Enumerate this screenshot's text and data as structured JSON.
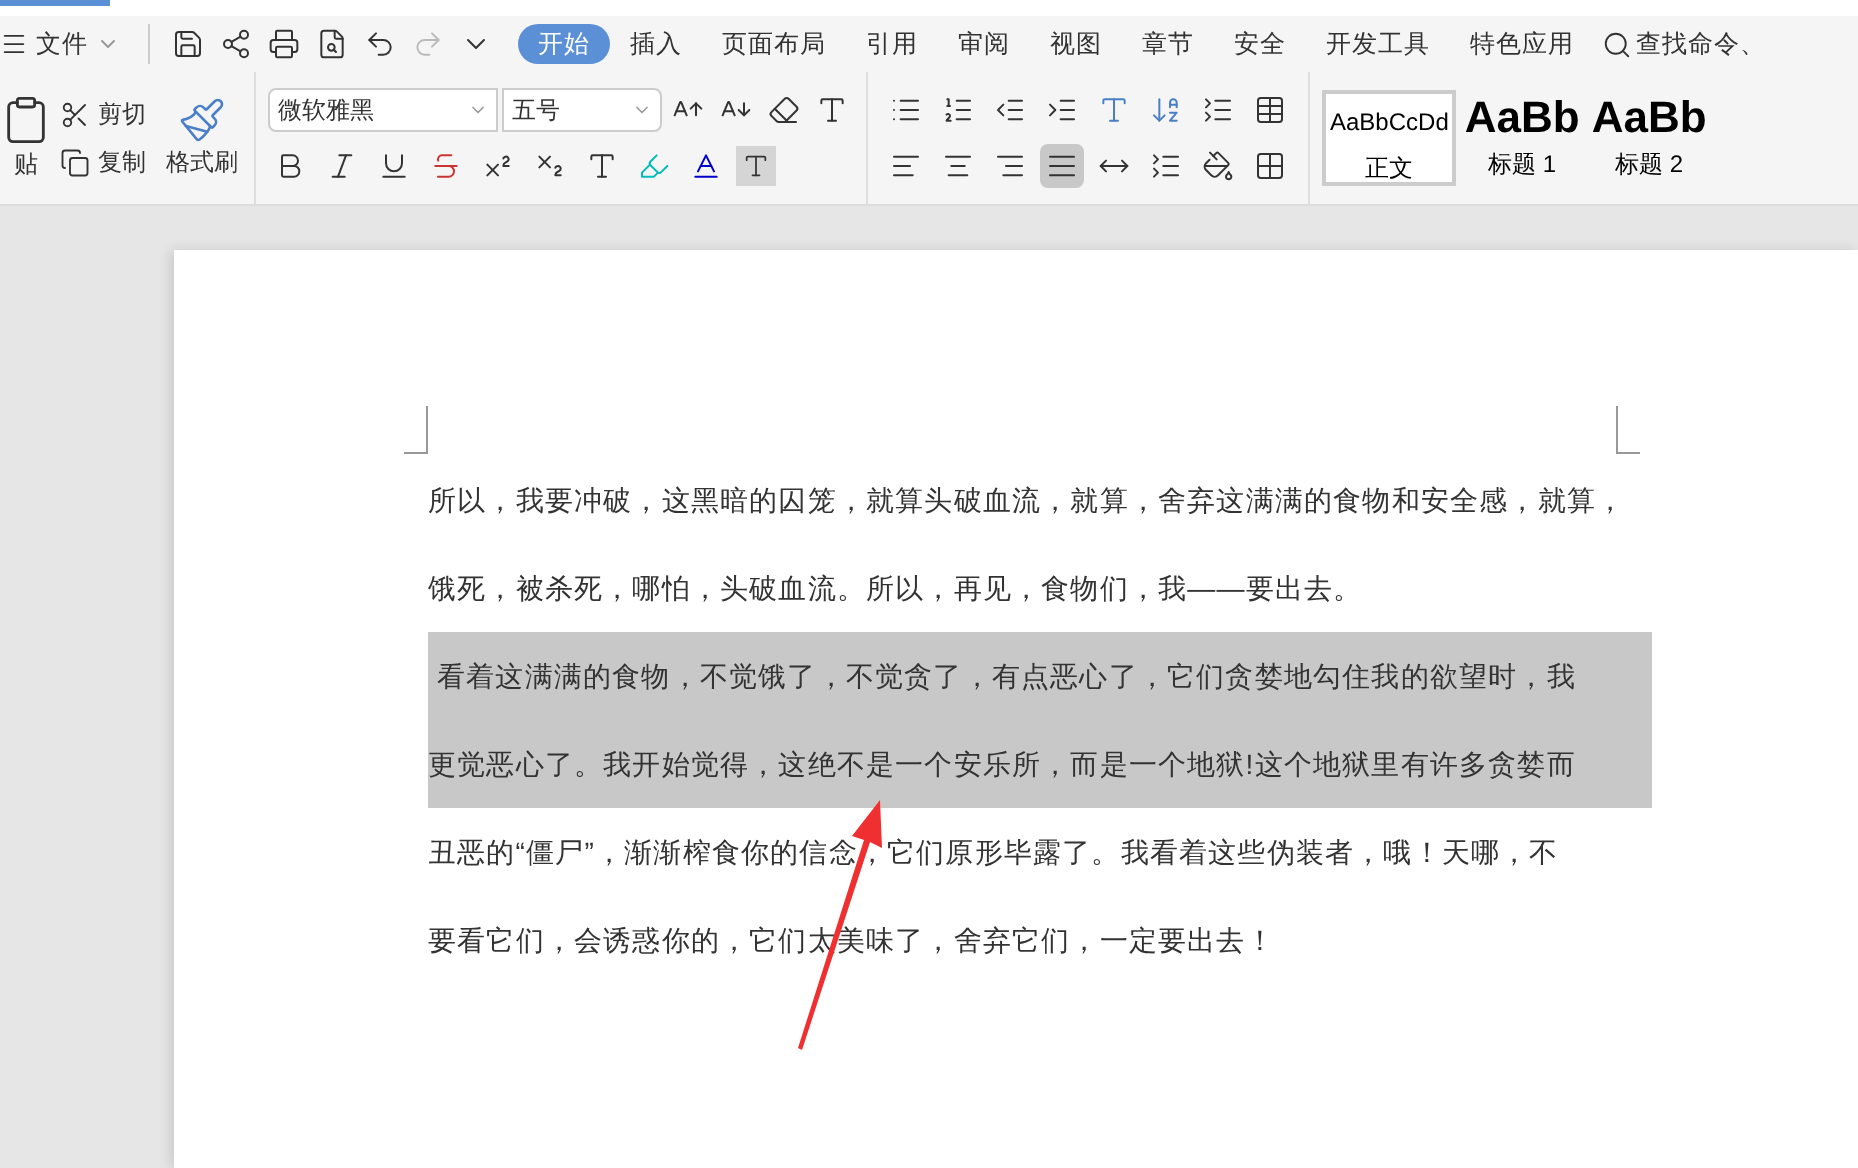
{
  "menu": {
    "file": "文件",
    "tabs": [
      {
        "label": "开始",
        "selected": true
      },
      {
        "label": "插入",
        "selected": false
      },
      {
        "label": "页面布局",
        "selected": false
      },
      {
        "label": "引用",
        "selected": false
      },
      {
        "label": "审阅",
        "selected": false
      },
      {
        "label": "视图",
        "selected": false
      },
      {
        "label": "章节",
        "selected": false
      },
      {
        "label": "安全",
        "selected": false
      },
      {
        "label": "开发工具",
        "selected": false
      },
      {
        "label": "特色应用",
        "selected": false
      }
    ],
    "search": "查找命令、"
  },
  "ribbon": {
    "paste": "贴",
    "cut": "剪切",
    "copy": "复制",
    "format_painter": "格式刷",
    "font": "微软雅黑",
    "size": "五号",
    "alignment": [
      {
        "kind": "left",
        "selected": false
      },
      {
        "kind": "center",
        "selected": false
      },
      {
        "kind": "right",
        "selected": false
      },
      {
        "kind": "justify",
        "selected": true
      },
      {
        "kind": "distribute",
        "selected": false
      }
    ],
    "styles": [
      {
        "preview": "AaBbCcDd",
        "label": "正文",
        "selected": true,
        "kind": "body"
      },
      {
        "preview": "AaBb",
        "label": "标题 1",
        "selected": false,
        "kind": "heading"
      },
      {
        "preview": "AaBb",
        "label": "标题 2",
        "selected": false,
        "kind": "heading"
      }
    ]
  },
  "document": {
    "lines": [
      {
        "text": "所以，我要冲破，这黑暗的囚笼，就算头破血流，就算，舍弃这满满的食物和安全感，就算，",
        "selected": false
      },
      {
        "text": "饿死，被杀死，哪怕，头破血流。所以，再见，食物们，我——要出去。",
        "selected": false
      },
      {
        "text": " 看着这满满的食物，不觉饿了，不觉贪了，有点恶心了，它们贪婪地勾住我的欲望时，我",
        "selected": true
      },
      {
        "text": "更觉恶心了。我开始觉得，这绝不是一个安乐所，而是一个地狱!这个地狱里有许多贪婪而",
        "selected": true
      },
      {
        "text": "丑恶的“僵尸”，渐渐榨食你的信念，它们原形毕露了。我看着这些伪装者，哦！天哪，不",
        "selected": false
      },
      {
        "text": "要看它们，会诱惑你的，它们太美味了，舍弃它们，一定要出去！",
        "selected": false
      }
    ]
  }
}
